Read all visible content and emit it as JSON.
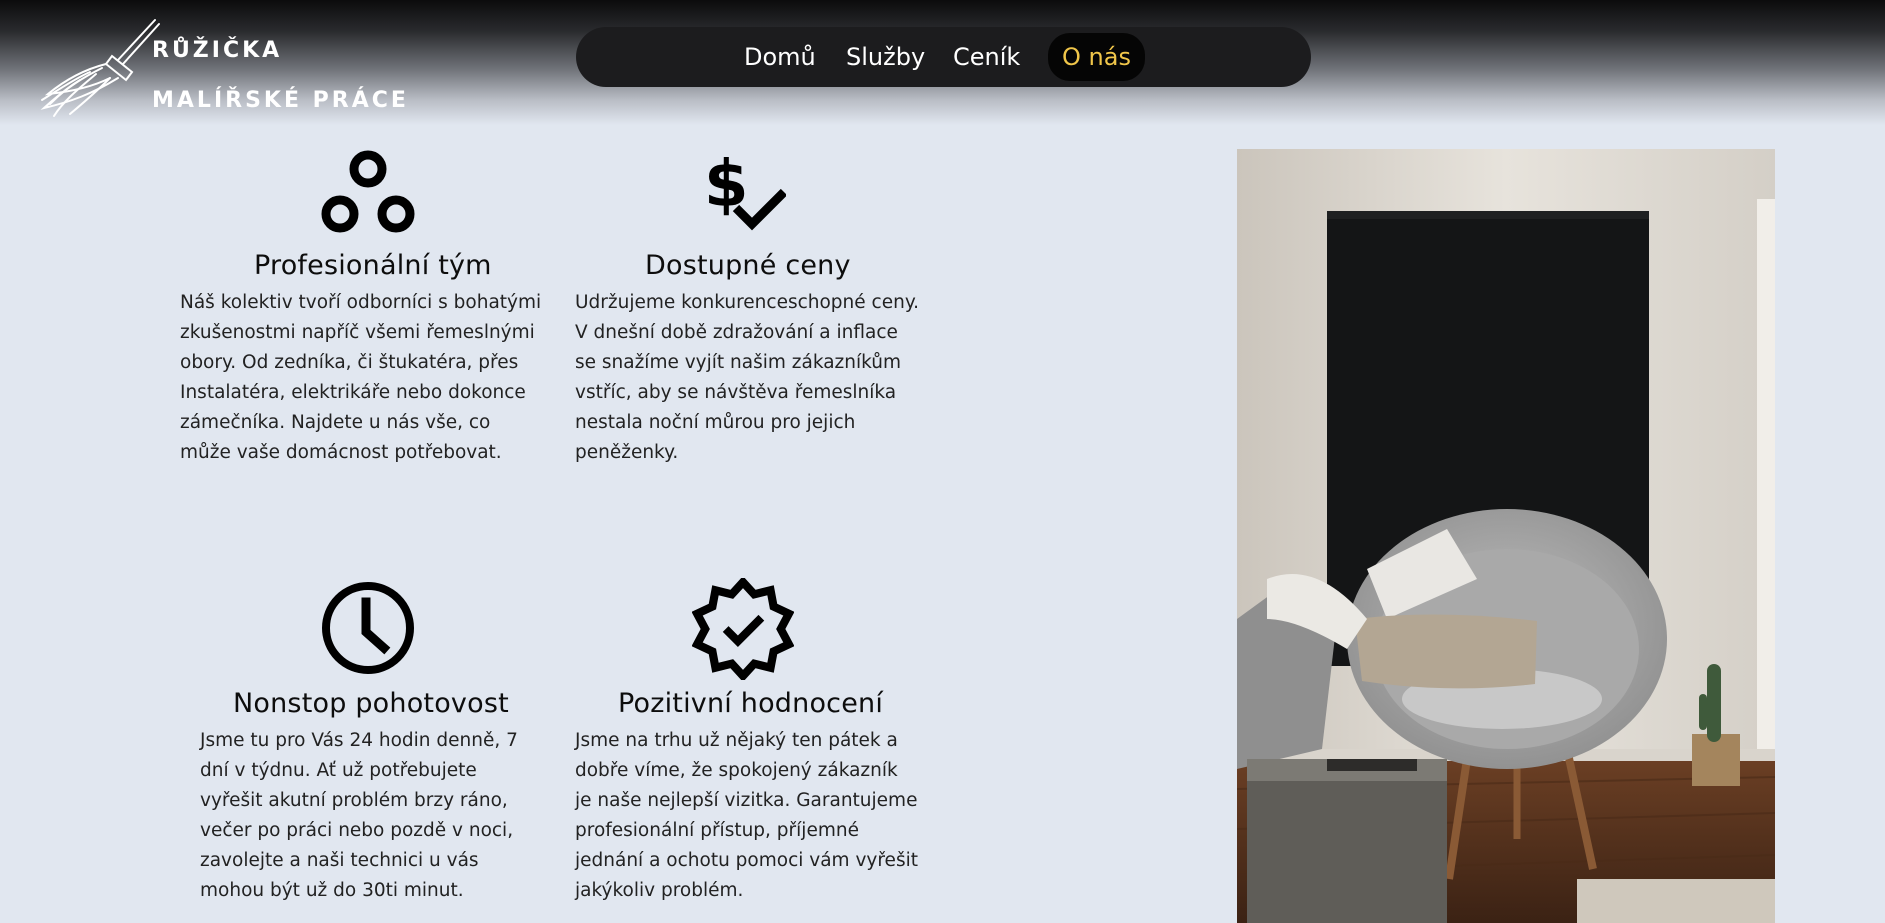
{
  "brand": {
    "line1": "RŮŽIČKA",
    "line2": "MALÍŘSKÉ PRÁCE",
    "icon": "paintbrush-icon"
  },
  "nav": {
    "items": [
      {
        "label": "Domů"
      },
      {
        "label": "Služby"
      },
      {
        "label": "Ceník"
      },
      {
        "label": "O nás",
        "active": true
      }
    ]
  },
  "features": [
    {
      "icon": "team-circles-icon",
      "title": "Profesionální tým",
      "text": "Náš kolektiv tvoří odborníci s bohatými zkušenostmi napříč všemi řemeslnými obory. Od zedníka, či štukatéra, přes Instalatéra, elektrikáře nebo dokonce zámečníka. Najdete u nás vše, co může vaše domácnost potřebovat."
    },
    {
      "icon": "dollar-check-icon",
      "title": "Dostupné ceny",
      "text": "Udržujeme konkurenceschopné ceny. V dnešní době zdražování a inflace se snažíme vyjít našim zákazníkům vstříc, aby se návštěva řemeslníka nestala noční můrou pro jejich peněženky."
    },
    {
      "icon": "clock-icon",
      "title": "Nonstop pohotovost",
      "text": "Jsme tu pro Vás 24 hodin denně, 7 dní v týdnu. Ať už potřebujete vyřešit akutní problém brzy ráno, večer po práci nebo pozdě v noci, zavolejte a naši technici u vás mohou být už do 30ti minut."
    },
    {
      "icon": "verified-badge-icon",
      "title": "Pozitivní hodnocení",
      "text": "Jsme na trhu už nějaký ten pátek a dobře víme, že spokojený zákazník je naše nejlepší vizitka. Garantujeme profesionální přístup, příjemné jednání a ochotu pomoci vám vyřešit jakýkoliv problém."
    }
  ],
  "colors": {
    "background": "#e1e7f0",
    "nav_bg": "#1c1c1e",
    "nav_active_text": "#f0c64a",
    "text": "#111111"
  }
}
